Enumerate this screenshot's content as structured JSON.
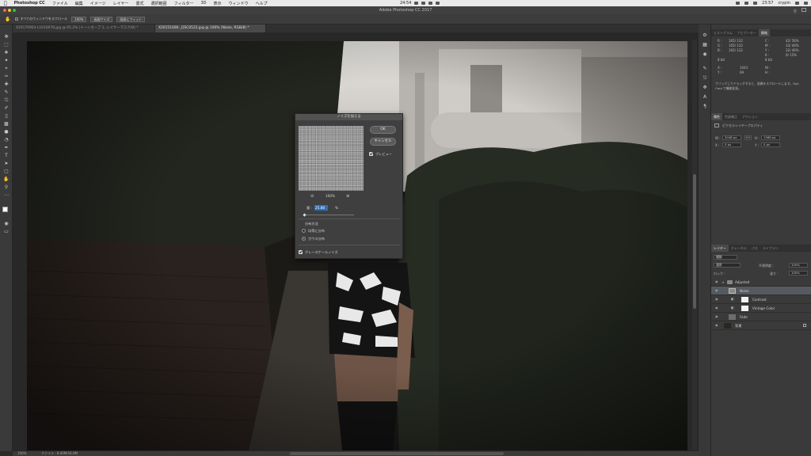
{
  "menubar": {
    "app": "Photoshop CC",
    "items": [
      "ファイル",
      "編集",
      "イメージ",
      "レイヤー",
      "書式",
      "選択範囲",
      "フィルター",
      "3D",
      "表示",
      "ウィンドウ",
      "ヘルプ"
    ],
    "center_time": "24:54",
    "clock": "23:57",
    "user": "crypin"
  },
  "window": {
    "title": "Adobe Photoshop CC 2017"
  },
  "options": {
    "scroll_all_label": "すべてのウィンドウをスクロール",
    "zoom_value": "100%",
    "fit_screen_label": "画面サイズ",
    "fill_screen_label": "画面にフィット"
  },
  "tabs": [
    {
      "label": "X20170903-L1010978.jpg @ 65.2% (トーンカーブ 1, レイヤーマスク/8) *"
    },
    {
      "label": "X20151006-_DSC0522.jpg @ 100% (Noise, RGB/8) *"
    }
  ],
  "dialog": {
    "title": "ノイズを加える",
    "ok_label": "OK",
    "cancel_label": "キャンセル",
    "preview_label": "プレビュー",
    "preview_checked": true,
    "zoom_level": "100%",
    "amount_label": "量 :",
    "amount_value": "25.88",
    "amount_unit": "%",
    "distribution_label": "分布方法",
    "uniform_label": "均等に分布",
    "gaussian_label": "ガウス分布",
    "gaussian_selected": true,
    "mono_label": "グレースケールノイズ",
    "mono_checked": true
  },
  "info_panel": {
    "tabs": [
      "ヒストグラム",
      "ナビゲーター",
      "情報"
    ],
    "active_tab": "情報",
    "r_label": "R :",
    "g_label": "G :",
    "b_label": "B :",
    "r1": "165/ 132",
    "g1": "165/ 132",
    "b1": "165/ 132",
    "c_label": "C :",
    "m_label": "M :",
    "y_label": "Y :",
    "k_label": "K :",
    "c_val": "42/ 56%",
    "m_val": "33/ 46%",
    "y_val": "32/ 46%",
    "k_val": "0/ 15%",
    "bit_left": "8 bit",
    "bit_right": "8 bit",
    "x_label": "X :",
    "y2_label": "Y :",
    "x_val": "1043",
    "y_val2": "69",
    "w_label": "W :",
    "h_label": "H :",
    "hint_1": "クリックしてドラッグすると、画像をスクロールします。Opt、",
    "hint_2": "Cmd で機能拡張。"
  },
  "properties_panel": {
    "tabs": [
      "属性",
      "色調補正",
      "アクション"
    ],
    "active_tab": "属性",
    "heading": "ピクセルレイヤープロパティ",
    "w_label": "W :",
    "w_value": "2048 px",
    "h_label": "H :",
    "h_value": "1366 px",
    "x_label": "X :",
    "x_value": "0 px",
    "y_label": "Y :",
    "y_value": "0 px",
    "link_label": "GO"
  },
  "layers_panel": {
    "tabs": [
      "レイヤー",
      "チャンネル",
      "パス",
      "ライブラリ"
    ],
    "active_tab": "レイヤー",
    "filter_label": "種類",
    "blend_mode": "通常",
    "opacity_label": "不透明度 :",
    "opacity_value": "100%",
    "lock_label": "ロック :",
    "fill_label": "塗り :",
    "fill_value": "100%",
    "layers": [
      {
        "name": "Adjusted",
        "type": "group",
        "selected": false
      },
      {
        "name": "Noise",
        "type": "pixel",
        "selected": true
      },
      {
        "name": "Contrast",
        "type": "adjustment",
        "selected": false
      },
      {
        "name": "Vintage Color",
        "type": "adjustment",
        "selected": false
      },
      {
        "name": "Fade",
        "type": "pixel",
        "selected": false
      },
      {
        "name": "背景",
        "type": "background",
        "selected": false
      }
    ]
  },
  "status": {
    "zoom": "100%",
    "doc_size": "ファイル : 8.00M/16.0M"
  },
  "colors": {
    "accent_selection": "#2f6fb5",
    "selected_layer": "#555a60",
    "panel_bg": "#3a3a3a"
  }
}
